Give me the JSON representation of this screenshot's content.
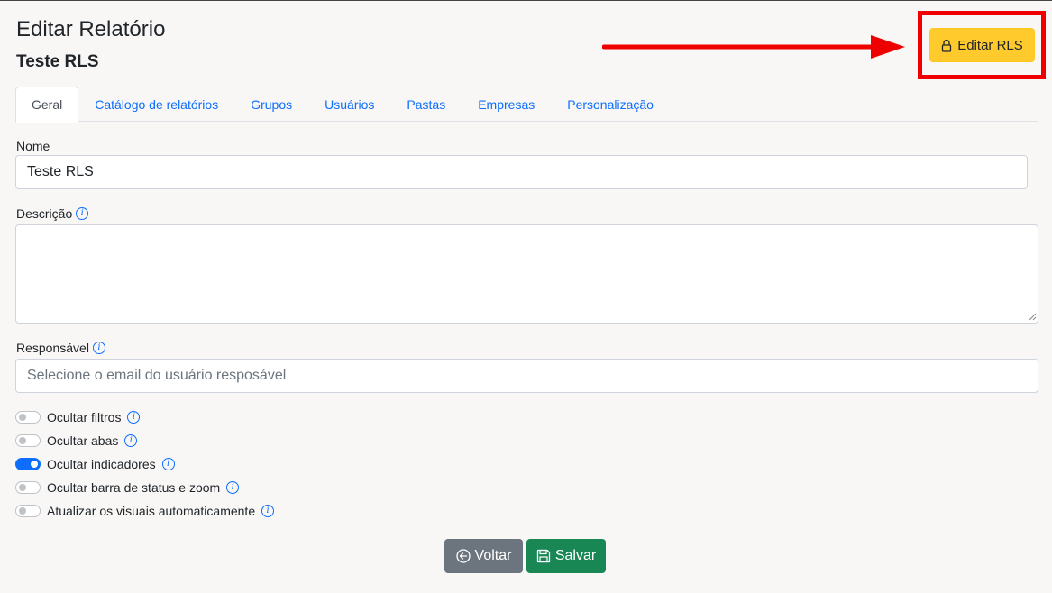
{
  "page": {
    "title": "Editar Relatório",
    "subtitle": "Teste RLS"
  },
  "rls_button": {
    "label": "Editar RLS",
    "icon": "lock-icon"
  },
  "annotation": {
    "highlight_color": "#ee0000"
  },
  "tabs": [
    {
      "label": "Geral",
      "active": true
    },
    {
      "label": "Catálogo de relatórios",
      "active": false
    },
    {
      "label": "Grupos",
      "active": false
    },
    {
      "label": "Usuários",
      "active": false
    },
    {
      "label": "Pastas",
      "active": false
    },
    {
      "label": "Empresas",
      "active": false
    },
    {
      "label": "Personalização",
      "active": false
    }
  ],
  "form": {
    "nome": {
      "label": "Nome",
      "value": "Teste RLS"
    },
    "descricao": {
      "label": "Descrição",
      "value": "",
      "info_icon": "info-icon"
    },
    "responsavel": {
      "label": "Responsável",
      "placeholder": "Selecione o email do usuário resposável",
      "info_icon": "info-icon"
    }
  },
  "switches": [
    {
      "label": "Ocultar filtros",
      "checked": false
    },
    {
      "label": "Ocultar abas",
      "checked": false
    },
    {
      "label": "Ocultar indicadores",
      "checked": true
    },
    {
      "label": "Ocultar barra de status e zoom",
      "checked": false
    },
    {
      "label": "Atualizar os visuais automaticamente",
      "checked": false
    }
  ],
  "actions": {
    "back_label": "Voltar",
    "back_icon": "arrow-left-circle-icon",
    "save_label": "Salvar",
    "save_icon": "floppy-disk-icon"
  },
  "colors": {
    "primary": "#0d6efd",
    "warning": "#ffca2c",
    "secondary": "#6c757d",
    "success": "#198754"
  }
}
